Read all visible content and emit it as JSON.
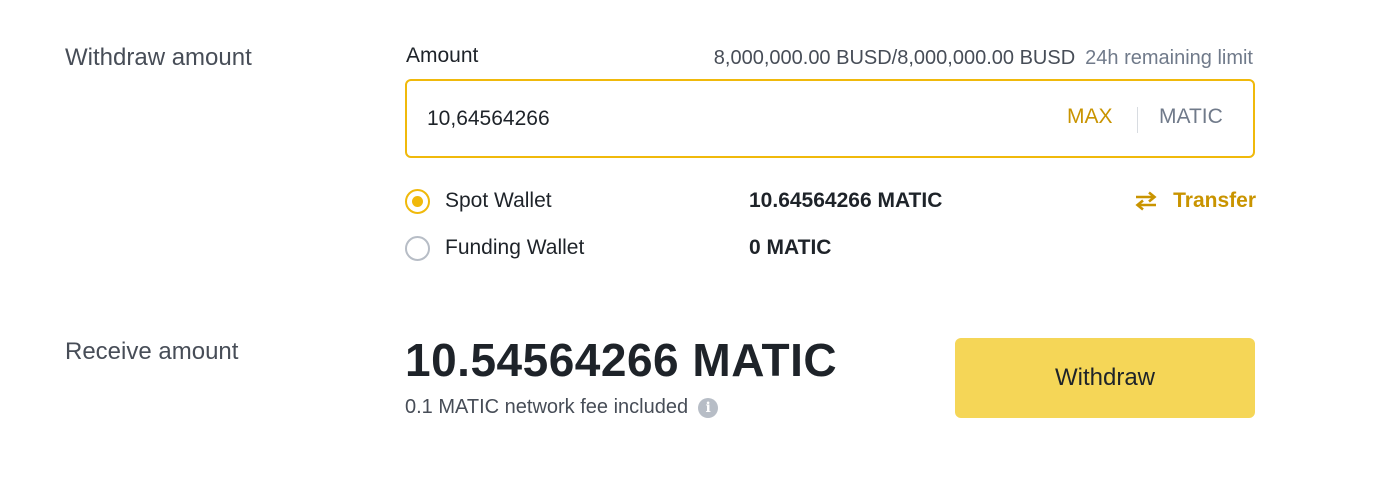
{
  "withdraw": {
    "section_label": "Withdraw amount",
    "amount_label": "Amount",
    "limit_value": "8,000,000.00 BUSD/8,000,000.00 BUSD",
    "limit_note": "24h remaining limit",
    "amount_value": "10,64564266",
    "max_label": "MAX",
    "unit": "MATIC"
  },
  "wallets": [
    {
      "name": "Spot Wallet",
      "balance": "10.64564266 MATIC",
      "selected": true
    },
    {
      "name": "Funding Wallet",
      "balance": "0 MATIC",
      "selected": false
    }
  ],
  "transfer": {
    "label": "Transfer",
    "icon": "transfer-arrows-icon"
  },
  "receive": {
    "section_label": "Receive amount",
    "value": "10.54564266 MATIC",
    "fee_note": "0.1 MATIC network fee included",
    "info_icon": "info-icon"
  },
  "actions": {
    "withdraw_label": "Withdraw"
  },
  "colors": {
    "accent": "#f0b90b",
    "accent_text": "#c99400",
    "button_bg": "#f5d657",
    "text_primary": "#1e2329",
    "text_secondary": "#707a8a"
  }
}
